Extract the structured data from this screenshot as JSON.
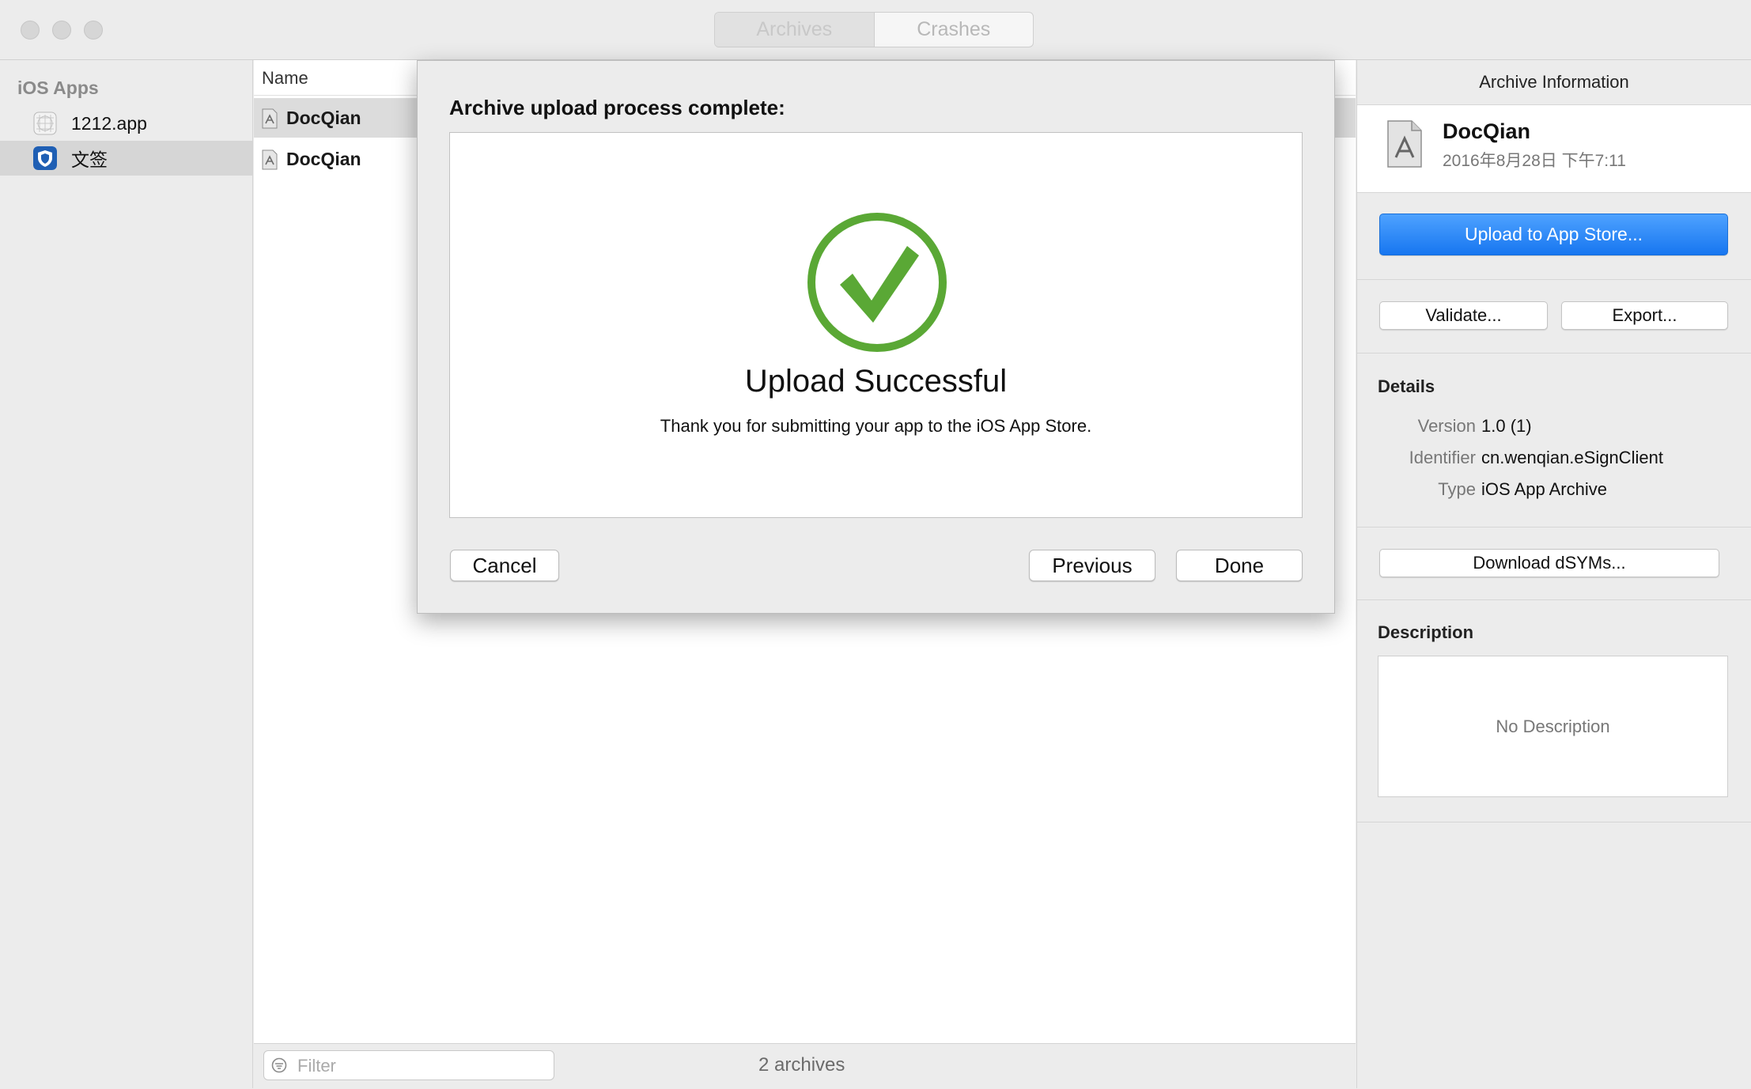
{
  "window": {
    "tabs": [
      "Archives",
      "Crashes"
    ]
  },
  "sidebar": {
    "header": "iOS Apps",
    "items": [
      {
        "label": "1212.app"
      },
      {
        "label": "文签"
      }
    ]
  },
  "list": {
    "column_name": "Name",
    "rows": [
      {
        "name": "DocQian"
      },
      {
        "name": "DocQian"
      }
    ],
    "filter_placeholder": "Filter",
    "count_text": "2 archives"
  },
  "inspector": {
    "title": "Archive Information",
    "archive_name": "DocQian",
    "archive_date": "2016年8月28日 下午7:11",
    "upload_label": "Upload to App Store...",
    "validate_label": "Validate...",
    "export_label": "Export...",
    "details_title": "Details",
    "details": [
      {
        "key": "Version",
        "value": "1.0 (1)"
      },
      {
        "key": "Identifier",
        "value": "cn.wenqian.eSignClient"
      },
      {
        "key": "Type",
        "value": "iOS App Archive"
      }
    ],
    "dsyms_label": "Download dSYMs...",
    "description_title": "Description",
    "description_text": "No Description"
  },
  "sheet": {
    "title": "Archive upload process complete:",
    "heading": "Upload Successful",
    "message": "Thank you for submitting your app to the iOS App Store.",
    "cancel_label": "Cancel",
    "previous_label": "Previous",
    "done_label": "Done"
  },
  "colors": {
    "success_green": "#5aa835",
    "primary_blue": "#1776f0"
  }
}
